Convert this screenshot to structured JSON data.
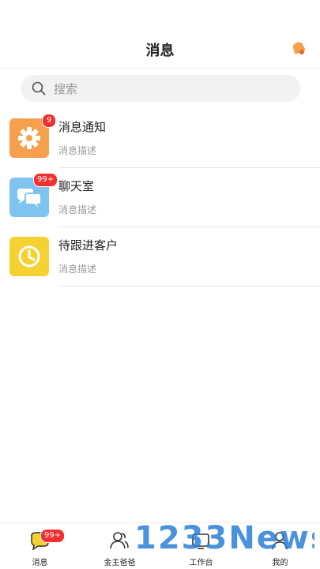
{
  "header": {
    "title": "消息"
  },
  "search": {
    "placeholder": "搜索"
  },
  "messages": [
    {
      "name": "消息通知",
      "description": "消息描述",
      "badge": "9",
      "icon": "gear-icon",
      "color": "#f5a04c"
    },
    {
      "name": "聊天室",
      "description": "消息描述",
      "badge": "99+",
      "icon": "chat-bubbles-icon",
      "color": "#7fc4f0"
    },
    {
      "name": "待跟进客户",
      "description": "消息描述",
      "badge": "",
      "icon": "clock-icon",
      "color": "#f5d132"
    }
  ],
  "tabs": [
    {
      "label": "消息",
      "badge": "99+",
      "icon": "message-bubble-icon",
      "active": true
    },
    {
      "label": "金主爸爸",
      "icon": "users-icon"
    },
    {
      "label": "工作台",
      "icon": "workbench-icon"
    },
    {
      "label": "我的",
      "icon": "person-icon"
    }
  ],
  "watermark": {
    "text": "1233News"
  },
  "colors": {
    "badge": "#f23030",
    "accent": "#f5a04c",
    "background": "#ffffff"
  }
}
